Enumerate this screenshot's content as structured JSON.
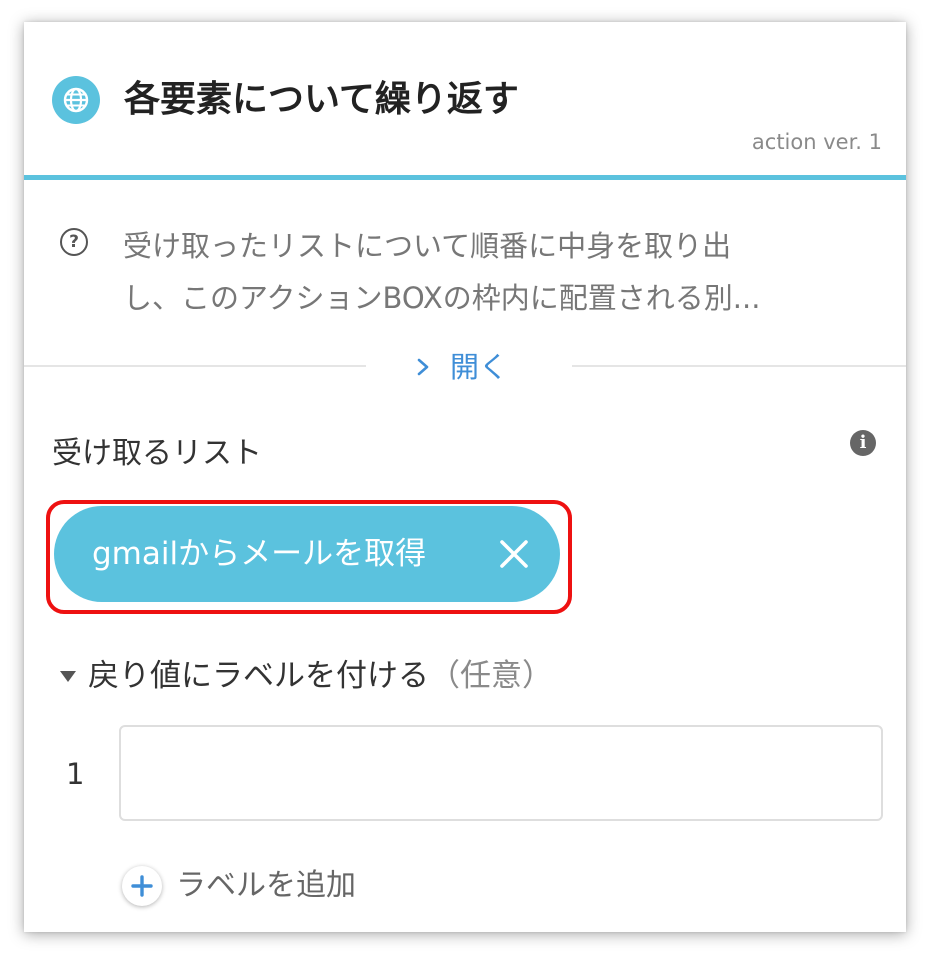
{
  "header": {
    "icon": "globe-icon",
    "title": "各要素について繰り返す",
    "version": "action ver. 1",
    "accent_color": "#5bc2de"
  },
  "description": {
    "help_icon": "question-circle-icon",
    "line1": "受け取ったリストについて順番に中身を取り出",
    "line2": "し、このアクションBOXの枠内に配置される別...",
    "expand_label": "開く",
    "expand_icon": "chevron-right-icon"
  },
  "input_list": {
    "label": "受け取るリスト",
    "info_icon": "info-icon",
    "chip": {
      "label": "gmailからメールを取得",
      "remove_icon": "close-icon"
    },
    "highlight_color": "#ee1111"
  },
  "return_labels": {
    "section_title": "戻り値にラベルを付ける",
    "optional": "（任意）",
    "rows": [
      {
        "number": "1",
        "value": "",
        "placeholder": ""
      }
    ],
    "add_label": "ラベルを追加",
    "add_icon": "plus-icon"
  }
}
